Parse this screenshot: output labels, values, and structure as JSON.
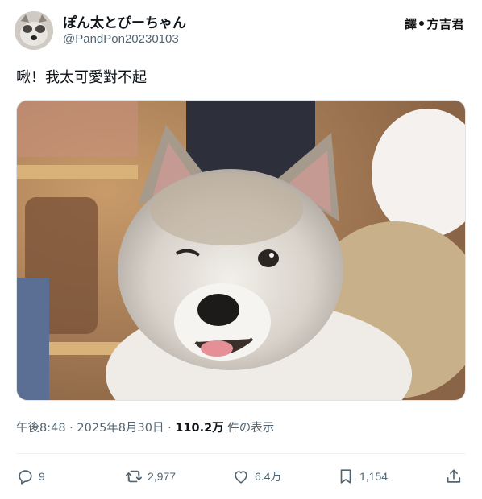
{
  "author": {
    "display_name": "ぽん太とぴーちゃん",
    "handle": "@PandPon20230103",
    "avatar": "shiba-avatar"
  },
  "watermark": {
    "left": "譯",
    "right": "方吉君"
  },
  "tweet": {
    "text": "啾！我太可愛對不起",
    "media": {
      "description_icon": "winking-shiba-photo"
    }
  },
  "meta": {
    "time": "午後8:48",
    "sep1": "·",
    "date": "2025年8月30日",
    "sep2": "·",
    "views_count": "110.2万",
    "views_label": "件の表示"
  },
  "actions": {
    "replies": "9",
    "reposts": "2,977",
    "likes": "6.4万",
    "bookmarks": "1,154"
  },
  "colors": {
    "secondary_text": "#536471",
    "primary_text": "#0f1419"
  }
}
